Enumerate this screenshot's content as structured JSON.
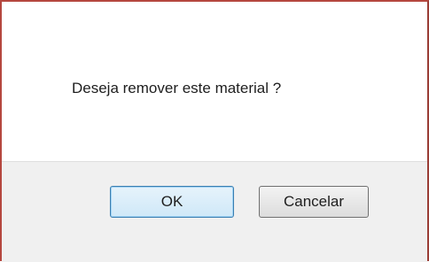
{
  "dialog": {
    "message": "Deseja remover este material ?",
    "ok_label": "OK",
    "cancel_label": "Cancelar"
  },
  "colors": {
    "border": "#b5473f",
    "footer_background": "#f0f0f0",
    "ok_border": "#3c7fb1"
  }
}
